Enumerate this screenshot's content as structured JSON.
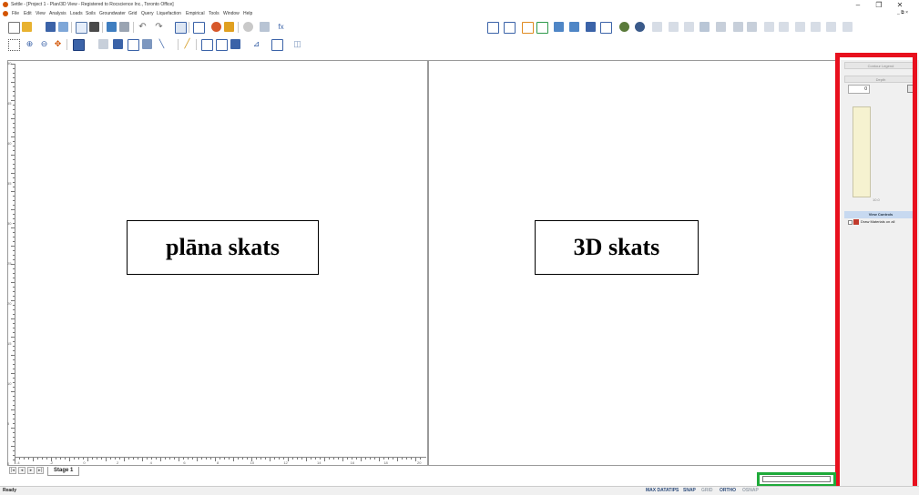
{
  "window": {
    "title": "Settle - [Project 1 - Plan/3D View - Registered to Rocscience Inc., Toronto Office]",
    "minimize": "–",
    "restore": "❐",
    "close": "✕",
    "mdi_controls": "_ ⧉ ×"
  },
  "menu": [
    "File",
    "Edit",
    "View",
    "Analysis",
    "Loads",
    "Soils",
    "Groundwater",
    "Grid",
    "Query",
    "Liquefaction",
    "Empirical",
    "Tools",
    "Window",
    "Help"
  ],
  "views": {
    "plan_label": "plāna skats",
    "view3d_label": "3D skats"
  },
  "ruler": {
    "v_labels": [
      "0",
      "5",
      "10",
      "15",
      "20",
      "25",
      "30",
      "35",
      "40",
      "45",
      "50"
    ],
    "h_labels": [
      "-4",
      "-2",
      "0",
      "2",
      "4",
      "6",
      "8",
      "10",
      "12",
      "14",
      "16",
      "18",
      "20"
    ]
  },
  "tabs": {
    "first": "|◂",
    "prev": "◂",
    "next": "▸",
    "last": "▸|",
    "stage": "Stage 1"
  },
  "sidepanel": {
    "contour_legend": "Contour Legend",
    "depth": "Depth",
    "depth_value": "0",
    "legend_bottom": "10.0",
    "view_controls": "View Controls",
    "tree_item": "Draw Materials on all"
  },
  "status": {
    "ready": "Ready",
    "max_datatips": "MAX DATATIPS",
    "snap": "SNAP",
    "grid": "GRID",
    "ortho": "ORTHO",
    "osnap": "OSNAP"
  },
  "colors": {
    "highlight_red": "#e8101e",
    "highlight_green": "#1faa3a",
    "legend_fill": "#f6f2d0",
    "view_controls_header": "#c7d9f0",
    "panel_bg": "#f0f0f0"
  }
}
